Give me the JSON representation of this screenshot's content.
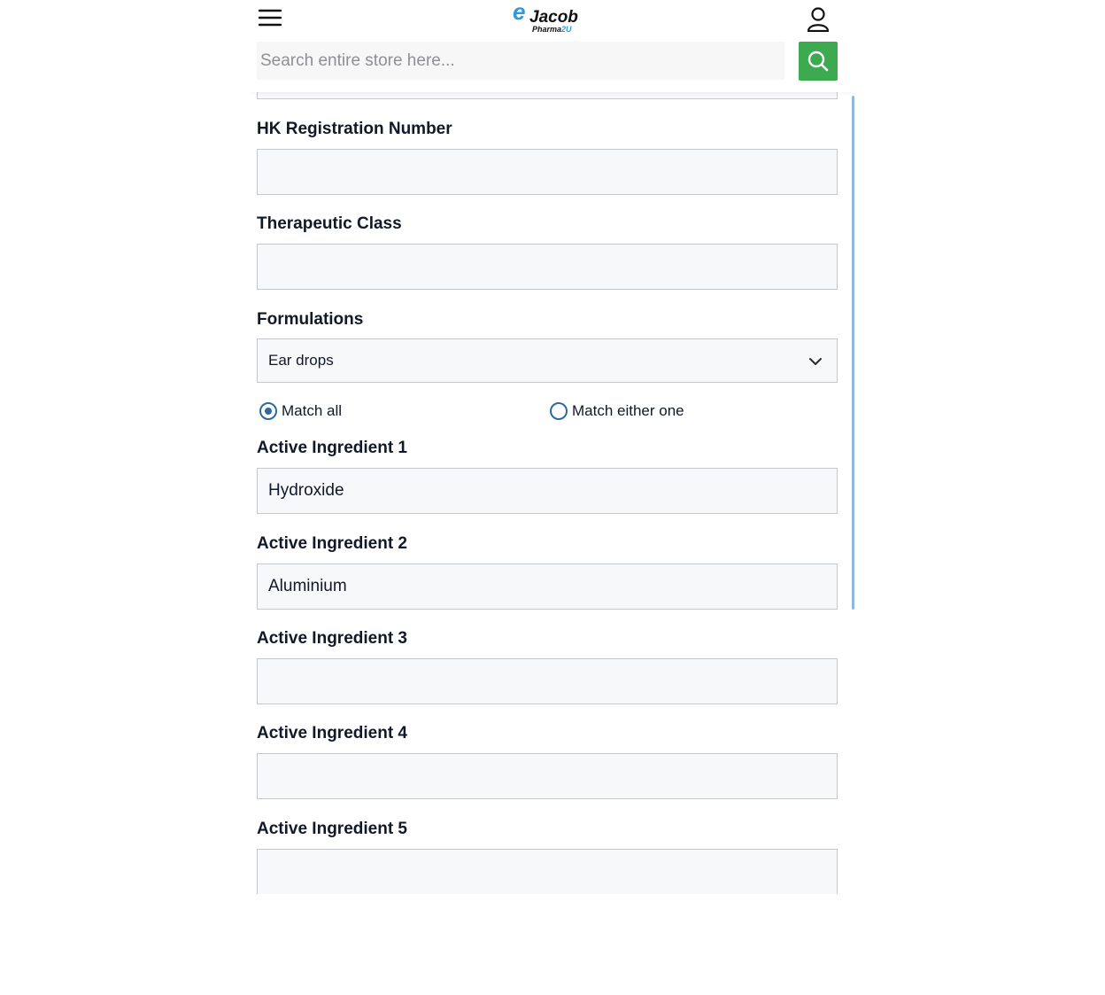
{
  "header": {
    "logo_text": "Jacob",
    "logo_subtext_a": "Pharma",
    "logo_subtext_b": "2U",
    "logo_letter": "e",
    "search": {
      "placeholder": "Search entire store here...",
      "value": ""
    },
    "icons": {
      "menu": "hamburger-menu-icon",
      "account": "user-icon",
      "search": "search-icon"
    },
    "colors": {
      "search_button": "#3daa4f",
      "logo_blue": "#2f9ad8"
    }
  },
  "form": {
    "hk_registration_number": {
      "label": "HK Registration Number",
      "value": ""
    },
    "therapeutic_class": {
      "label": "Therapeutic Class",
      "value": ""
    },
    "formulations": {
      "label": "Formulations",
      "selected": "Ear drops"
    },
    "match_mode": {
      "options": [
        {
          "label": "Match all",
          "checked": true
        },
        {
          "label": "Match either one",
          "checked": false
        }
      ]
    },
    "active_ingredients": [
      {
        "label": "Active Ingredient 1",
        "value": "Hydroxide"
      },
      {
        "label": "Active Ingredient 2",
        "value": "Aluminium"
      },
      {
        "label": "Active Ingredient 3",
        "value": ""
      },
      {
        "label": "Active Ingredient 4",
        "value": ""
      },
      {
        "label": "Active Ingredient 5",
        "value": ""
      }
    ]
  }
}
